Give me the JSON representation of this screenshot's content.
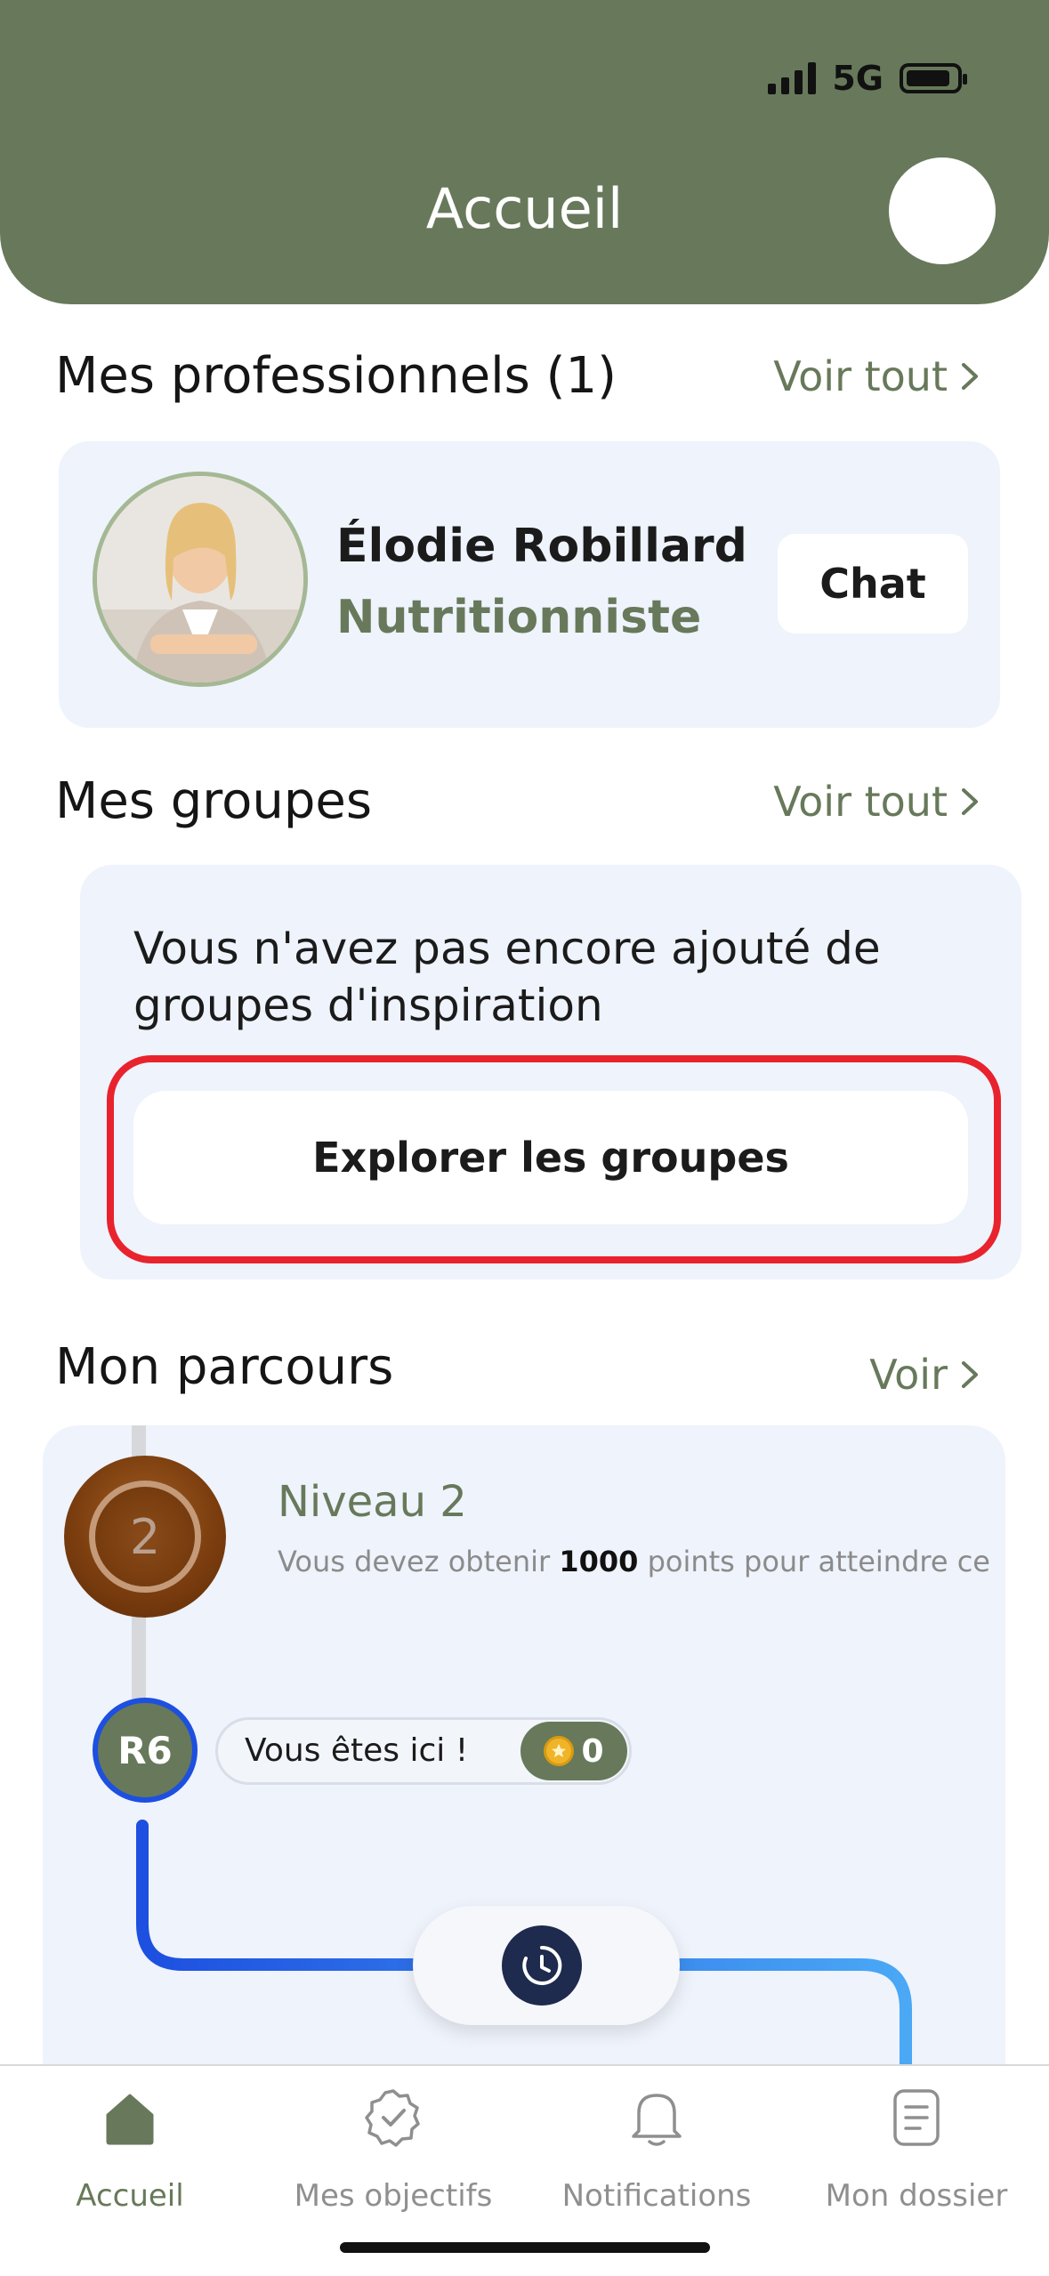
{
  "status_bar": {
    "network": "5G"
  },
  "header": {
    "title": "Accueil"
  },
  "professionals": {
    "title": "Mes professionnels (1)",
    "see_all": "Voir tout",
    "items": [
      {
        "name": "Élodie Robillard",
        "role": "Nutritionniste",
        "chat_label": "Chat"
      }
    ]
  },
  "groups": {
    "title": "Mes groupes",
    "see_all": "Voir tout",
    "empty_text": "Vous n'avez pas encore ajouté de groupes d'inspiration",
    "explore_label": "Explorer les groupes"
  },
  "journey": {
    "title": "Mon parcours",
    "see_label": "Voir",
    "level_number": "2",
    "level_title": "Niveau 2",
    "level_desc_prefix": "Vous devez obtenir ",
    "level_desc_points": "1000",
    "level_desc_suffix": " points pour atteindre ce",
    "current_badge": "R6",
    "here_label": "Vous êtes ici !",
    "points": "0"
  },
  "tabbar": {
    "items": [
      {
        "label": "Accueil",
        "icon": "home-icon",
        "active": true
      },
      {
        "label": "Mes objectifs",
        "icon": "badge-check-icon",
        "active": false
      },
      {
        "label": "Notifications",
        "icon": "bell-icon",
        "active": false
      },
      {
        "label": "Mon dossier",
        "icon": "document-icon",
        "active": false
      }
    ]
  },
  "colors": {
    "brand_green": "#67795a",
    "card_bg": "#eef3fc",
    "highlight_red": "#e8232e",
    "path_blue": "#1d4fe0"
  }
}
